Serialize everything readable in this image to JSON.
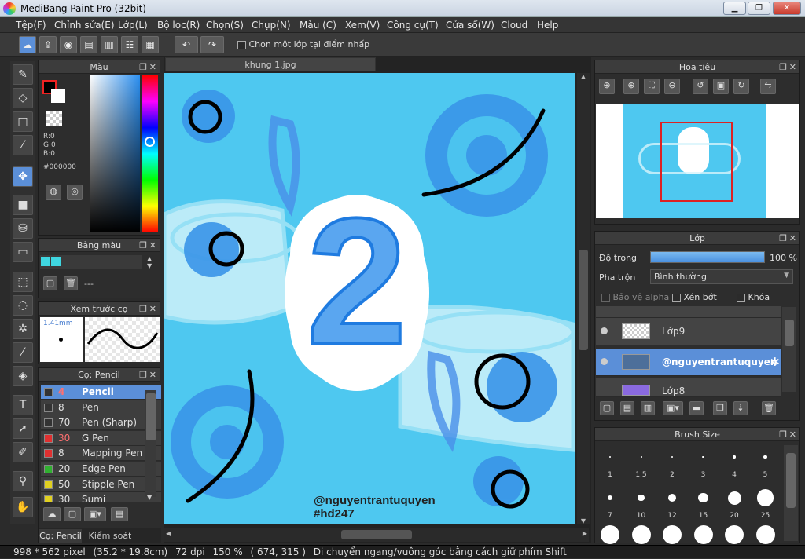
{
  "window": {
    "title": "MediBang Paint Pro (32bit)",
    "min_label": "▁",
    "max_label": "❐",
    "close_label": "✕"
  },
  "menu": [
    "Tệp(F)",
    "Chỉnh sửa(E)",
    "Lớp(L)",
    "Bộ lọc(R)",
    "Chọn(S)",
    "Chụp(N)",
    "Màu (C)",
    "Xem(V)",
    "Công cụ(T)",
    "Cửa sổ(W)",
    "Cloud",
    "Help"
  ],
  "toolbar": {
    "single_layer_label": "Chọn một lớp tại điểm nhấp"
  },
  "color_panel": {
    "title": "Màu",
    "r": "R:0",
    "g": "G:0",
    "b": "B:0",
    "hex": "#000000",
    "fg": "#000000",
    "bg": "#ffffff"
  },
  "palette_panel": {
    "title": "Bảng màu",
    "dash": "---",
    "swatches": [
      "#3fd6e0",
      "#3fd6e0"
    ]
  },
  "preview_panel": {
    "title": "Xem trước cọ",
    "size": "1.41mm"
  },
  "brush_panel": {
    "title": "Cọ: Pencil",
    "brushes": [
      {
        "size": "4",
        "name": "Pencil",
        "color": "#333333",
        "sizecolor": "#ff7070"
      },
      {
        "size": "8",
        "name": "Pen",
        "color": "#333333",
        "sizecolor": "#e0e0e0"
      },
      {
        "size": "70",
        "name": "Pen (Sharp)",
        "color": "#333333",
        "sizecolor": "#e0e0e0"
      },
      {
        "size": "30",
        "name": "G Pen",
        "color": "#e03030",
        "sizecolor": "#ff7070"
      },
      {
        "size": "8",
        "name": "Mapping Pen",
        "color": "#e03030",
        "sizecolor": "#e0e0e0"
      },
      {
        "size": "20",
        "name": "Edge Pen",
        "color": "#30b030",
        "sizecolor": "#e0e0e0"
      },
      {
        "size": "50",
        "name": "Stipple Pen",
        "color": "#e0d020",
        "sizecolor": "#e0e0e0"
      },
      {
        "size": "30",
        "name": "Sumi",
        "color": "#e0d020",
        "sizecolor": "#e0e0e0"
      }
    ],
    "tab1": "Cọ: Pencil",
    "tab2": "Kiểm soát cọ"
  },
  "document": {
    "tab": "khung 1.jpg",
    "text1": "@nguyentrantuquyen",
    "text2": "#hd247",
    "big": "2"
  },
  "navigator": {
    "title": "Hoa tiêu"
  },
  "layer_panel": {
    "title": "Lớp",
    "opacity_label": "Độ trong",
    "opacity_value": "100 %",
    "opacity": 1.0,
    "blend_label": "Pha trộn",
    "blend_value": "Bình thường",
    "protect_alpha": "Bảo vệ alpha",
    "clipping": "Xén bớt",
    "lock": "Khóa",
    "layers": [
      "Lớp9",
      "@nguyentrantuquyen",
      "Lớp8"
    ]
  },
  "brush_size_panel": {
    "title": "Brush Size",
    "sizes": [
      "1",
      "1.5",
      "2",
      "3",
      "4",
      "5",
      "7",
      "10",
      "12",
      "15",
      "20",
      "25"
    ]
  },
  "status": {
    "dims": "998 * 562 pixel",
    "cm": "(35.2 * 19.8cm)",
    "dpi": "72 dpi",
    "zoom": "150 %",
    "coords": "( 674, 315 )",
    "hint": "Di chuyển ngang/vuông góc bằng cách giữ phím Shift"
  }
}
